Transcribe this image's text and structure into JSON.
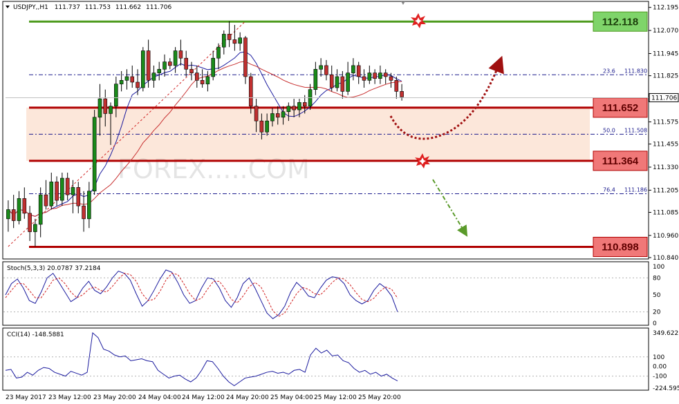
{
  "chart_data": [
    {
      "type": "candlestick",
      "title": "USDJPY,,H1",
      "header_values": [
        "111.737",
        "111.753",
        "111.662",
        "111.706"
      ],
      "current_price": "111.706",
      "ylim": [
        110.84,
        112.22
      ],
      "y_ticks": [
        "112.195",
        "112.070",
        "111.945",
        "111.825",
        "111.700",
        "111.575",
        "111.455",
        "111.330",
        "111.205",
        "111.085",
        "110.960",
        "110.840"
      ],
      "x_labels": [
        "23 May 2017",
        "23 May 12:00",
        "23 May 20:00",
        "24 May 04:00",
        "24 May 12:00",
        "24 May 20:00",
        "25 May 04:00",
        "25 May 12:00",
        "25 May 20:00"
      ],
      "levels": [
        {
          "label": "112.118",
          "price": 112.118,
          "color": "#4c9a1c",
          "box": "#7fd46a"
        },
        {
          "label": "111.652",
          "price": 111.652,
          "color": "#b00000",
          "box": "#f07878"
        },
        {
          "label": "111.364",
          "price": 111.364,
          "color": "#b00000",
          "box": "#f07878"
        },
        {
          "label": "110.898",
          "price": 110.898,
          "color": "#b00000",
          "box": "#f07878"
        }
      ],
      "fibonacci": [
        {
          "ratio": "23.6",
          "price": "111.830",
          "value": 111.83
        },
        {
          "ratio": "50.0",
          "price": "111.508",
          "value": 111.508
        },
        {
          "ratio": "76.4",
          "price": "111.186",
          "value": 111.186
        }
      ],
      "zone": [
        111.364,
        111.652
      ],
      "watermark": "FOREX.....COM",
      "candles": [
        [
          111.05,
          111.15,
          110.98,
          111.1
        ],
        [
          111.1,
          111.18,
          111.0,
          111.04
        ],
        [
          111.04,
          111.2,
          111.02,
          111.16
        ],
        [
          111.16,
          111.22,
          111.05,
          111.08
        ],
        [
          111.08,
          111.12,
          110.93,
          110.98
        ],
        [
          110.98,
          111.05,
          110.9,
          111.02
        ],
        [
          111.02,
          111.22,
          110.95,
          111.18
        ],
        [
          111.18,
          111.26,
          111.1,
          111.12
        ],
        [
          111.12,
          111.3,
          111.1,
          111.25
        ],
        [
          111.25,
          111.28,
          111.12,
          111.15
        ],
        [
          111.15,
          111.3,
          111.12,
          111.27
        ],
        [
          111.27,
          111.3,
          111.15,
          111.18
        ],
        [
          111.18,
          111.26,
          111.08,
          111.22
        ],
        [
          111.22,
          111.25,
          111.08,
          111.12
        ],
        [
          111.12,
          111.2,
          110.98,
          111.05
        ],
        [
          111.05,
          111.25,
          111.0,
          111.2
        ],
        [
          111.2,
          111.64,
          111.18,
          111.6
        ],
        [
          111.6,
          111.78,
          111.5,
          111.7
        ],
        [
          111.7,
          111.75,
          111.55,
          111.62
        ],
        [
          111.62,
          111.68,
          111.45,
          111.66
        ],
        [
          111.66,
          111.82,
          111.6,
          111.78
        ],
        [
          111.78,
          111.85,
          111.74,
          111.8
        ],
        [
          111.8,
          111.86,
          111.75,
          111.82
        ],
        [
          111.82,
          111.88,
          111.76,
          111.79
        ],
        [
          111.79,
          111.86,
          111.72,
          111.76
        ],
        [
          111.76,
          111.98,
          111.74,
          111.96
        ],
        [
          111.96,
          112.02,
          111.76,
          111.8
        ],
        [
          111.8,
          111.88,
          111.76,
          111.84
        ],
        [
          111.84,
          111.9,
          111.8,
          111.86
        ],
        [
          111.86,
          111.94,
          111.82,
          111.9
        ],
        [
          111.9,
          111.92,
          111.86,
          111.88
        ],
        [
          111.88,
          111.98,
          111.84,
          111.96
        ],
        [
          111.96,
          112.02,
          111.88,
          111.92
        ],
        [
          111.92,
          111.96,
          111.82,
          111.86
        ],
        [
          111.86,
          111.9,
          111.8,
          111.84
        ],
        [
          111.84,
          111.88,
          111.76,
          111.8
        ],
        [
          111.8,
          111.86,
          111.76,
          111.78
        ],
        [
          111.78,
          111.85,
          111.74,
          111.82
        ],
        [
          111.82,
          111.96,
          111.8,
          111.92
        ],
        [
          111.92,
          112.0,
          111.86,
          111.98
        ],
        [
          111.98,
          112.07,
          111.94,
          112.05
        ],
        [
          112.05,
          112.12,
          111.98,
          112.02
        ],
        [
          112.02,
          112.1,
          111.96,
          112.0
        ],
        [
          112.0,
          112.06,
          111.96,
          112.03
        ],
        [
          112.03,
          112.04,
          111.78,
          111.82
        ],
        [
          111.82,
          111.84,
          111.62,
          111.66
        ],
        [
          111.66,
          111.7,
          111.52,
          111.58
        ],
        [
          111.58,
          111.62,
          111.48,
          111.52
        ],
        [
          111.52,
          111.62,
          111.5,
          111.58
        ],
        [
          111.58,
          111.65,
          111.55,
          111.62
        ],
        [
          111.62,
          111.66,
          111.56,
          111.6
        ],
        [
          111.6,
          111.66,
          111.56,
          111.63
        ],
        [
          111.63,
          111.68,
          111.58,
          111.66
        ],
        [
          111.66,
          111.7,
          111.6,
          111.64
        ],
        [
          111.64,
          111.7,
          111.6,
          111.68
        ],
        [
          111.68,
          111.72,
          111.62,
          111.66
        ],
        [
          111.66,
          111.78,
          111.64,
          111.75
        ],
        [
          111.75,
          111.9,
          111.72,
          111.86
        ],
        [
          111.86,
          111.92,
          111.82,
          111.88
        ],
        [
          111.88,
          111.91,
          111.8,
          111.83
        ],
        [
          111.83,
          111.88,
          111.74,
          111.76
        ],
        [
          111.76,
          111.86,
          111.74,
          111.82
        ],
        [
          111.82,
          111.85,
          111.7,
          111.74
        ],
        [
          111.74,
          111.9,
          111.72,
          111.84
        ],
        [
          111.84,
          111.92,
          111.8,
          111.88
        ],
        [
          111.88,
          111.9,
          111.78,
          111.82
        ],
        [
          111.82,
          111.86,
          111.76,
          111.8
        ],
        [
          111.8,
          111.88,
          111.78,
          111.84
        ],
        [
          111.84,
          111.86,
          111.78,
          111.81
        ],
        [
          111.81,
          111.88,
          111.78,
          111.84
        ],
        [
          111.84,
          111.86,
          111.78,
          111.82
        ],
        [
          111.82,
          111.84,
          111.76,
          111.8
        ],
        [
          111.8,
          111.82,
          111.7,
          111.74
        ],
        [
          111.74,
          111.78,
          111.69,
          111.71
        ]
      ]
    },
    {
      "type": "line",
      "title": "Stoch(5,3,3) 20.0787 37.2184",
      "ylim": [
        0,
        100
      ],
      "y_ticks": [
        "100",
        "80",
        "50",
        "20",
        "0"
      ],
      "series": [
        {
          "name": "main",
          "color": "#1a1a9e",
          "values": [
            50,
            70,
            78,
            62,
            40,
            35,
            55,
            80,
            88,
            72,
            55,
            38,
            45,
            62,
            74,
            58,
            52,
            64,
            80,
            92,
            88,
            76,
            52,
            30,
            40,
            58,
            78,
            94,
            90,
            72,
            50,
            35,
            40,
            62,
            80,
            78,
            62,
            40,
            28,
            45,
            70,
            80,
            62,
            40,
            18,
            8,
            15,
            30,
            55,
            72,
            62,
            48,
            45,
            62,
            76,
            82,
            80,
            70,
            50,
            40,
            34,
            40,
            58,
            70,
            62,
            48,
            20
          ]
        },
        {
          "name": "signal",
          "color": "#d12020",
          "values": [
            45,
            58,
            70,
            70,
            58,
            45,
            45,
            60,
            76,
            80,
            70,
            55,
            45,
            50,
            60,
            64,
            58,
            55,
            65,
            78,
            88,
            86,
            74,
            52,
            40,
            42,
            56,
            76,
            88,
            86,
            70,
            52,
            40,
            44,
            60,
            74,
            74,
            60,
            42,
            36,
            48,
            64,
            72,
            64,
            44,
            22,
            12,
            18,
            35,
            52,
            63,
            60,
            52,
            50,
            60,
            72,
            80,
            78,
            68,
            54,
            42,
            38,
            44,
            56,
            64,
            60,
            44
          ]
        }
      ]
    },
    {
      "type": "line",
      "title": "CCI(14) -148.5881",
      "ylim": [
        -224.5955,
        349.6223
      ],
      "y_ticks": [
        "349.6223",
        "100",
        "0.00",
        "-100",
        "-224.5955"
      ],
      "series": [
        {
          "name": "cci",
          "color": "#1a1a9e",
          "values": [
            -40,
            -30,
            -120,
            -110,
            -60,
            -90,
            -40,
            -10,
            -20,
            -60,
            -80,
            -100,
            -50,
            -70,
            -90,
            -60,
            350,
            300,
            180,
            160,
            120,
            100,
            110,
            60,
            70,
            80,
            60,
            50,
            -40,
            -80,
            -120,
            -100,
            -90,
            -130,
            -160,
            -120,
            -40,
            60,
            50,
            -20,
            -100,
            -160,
            -200,
            -160,
            -120,
            -110,
            -100,
            -80,
            -60,
            -50,
            -70,
            -60,
            -80,
            -40,
            -30,
            -60,
            120,
            190,
            140,
            170,
            110,
            120,
            60,
            40,
            -20,
            -60,
            -40,
            -80,
            -60,
            -100,
            -80,
            -120,
            -150
          ]
        }
      ]
    }
  ]
}
